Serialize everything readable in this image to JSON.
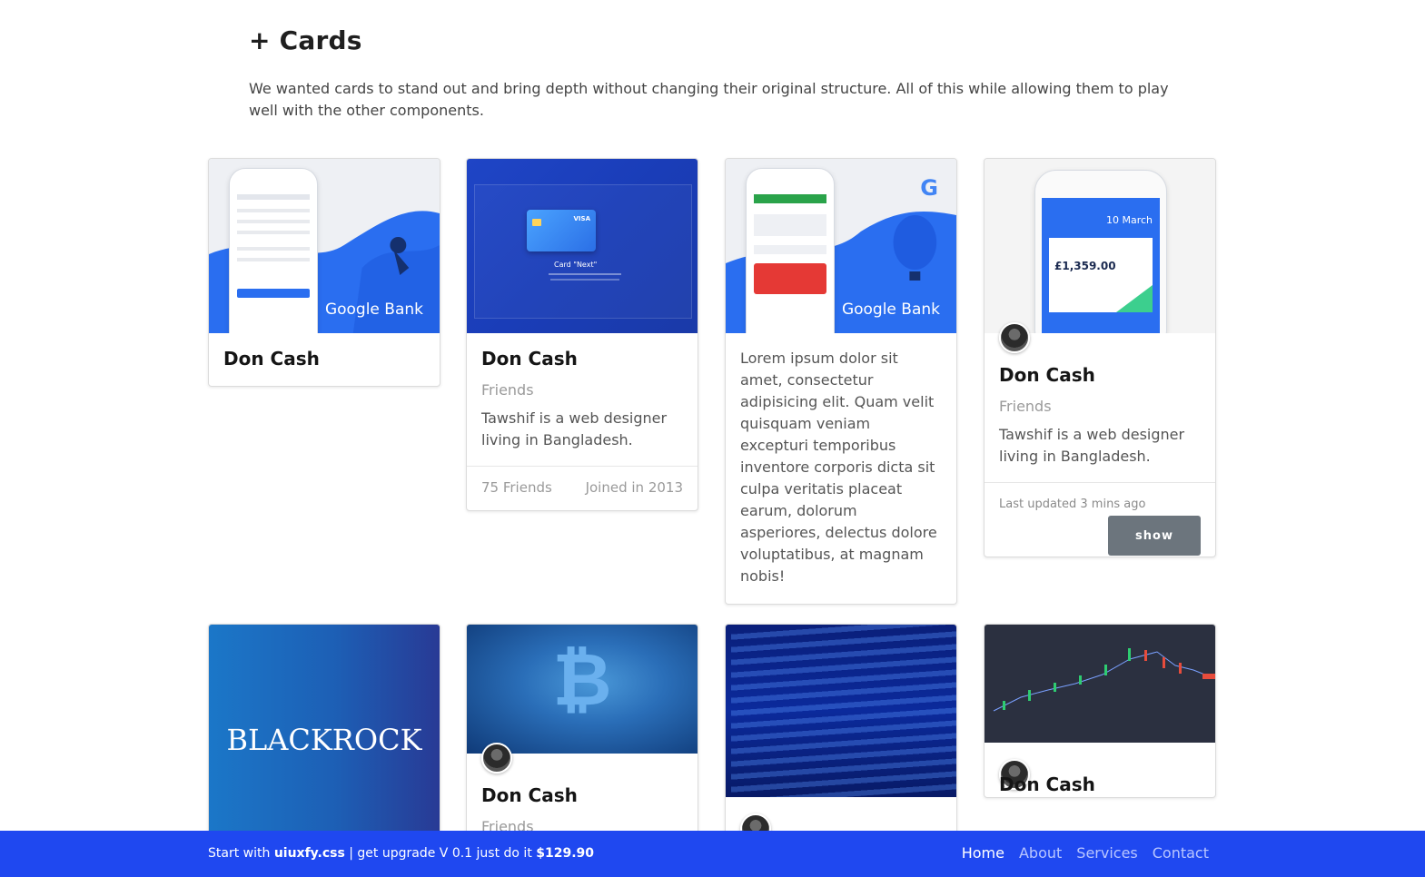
{
  "section": {
    "title": "+ Cards",
    "description": "We wanted cards to stand out and bring depth without changing their original structure. All of this while allowing them to play well with the other components."
  },
  "cards": [
    {
      "name": "Don Cash",
      "image_brand": "Google Bank"
    },
    {
      "name": "Don Cash",
      "subtitle": "Friends",
      "text": "Tawshif is a web designer living in Bangladesh.",
      "footer_left": "75 Friends",
      "footer_right": "Joined in 2013",
      "image_text": "Card \"Next\""
    },
    {
      "text": "Lorem ipsum dolor sit amet, consectetur adipisicing elit. Quam velit quisquam veniam excepturi temporibus inventore corporis dicta sit culpa veritatis placeat earum, dolorum asperiores, delectus dolore voluptatibus, at magnam nobis!",
      "image_brand": "Google Bank"
    },
    {
      "name": "Don Cash",
      "subtitle": "Friends",
      "text": "Tawshif is a web designer living in Bangladesh.",
      "updated": "Last updated 3 mins ago",
      "button": "show",
      "image_date": "10 March",
      "image_amount": "£1,359.00"
    },
    {
      "image_brand": "BlackRock"
    },
    {
      "name": "Don Cash",
      "subtitle": "Friends"
    },
    {},
    {
      "name": "Don Cash"
    }
  ],
  "footer": {
    "promo_start": "Start with ",
    "promo_brand": "uiuxfy.css",
    "promo_mid": " | get upgrade V 0.1 just do it ",
    "promo_price": "$129.90",
    "nav": [
      "Home",
      "About",
      "Services",
      "Contact"
    ]
  },
  "colors": {
    "accent": "#1f48f0",
    "button": "#6c757d"
  }
}
